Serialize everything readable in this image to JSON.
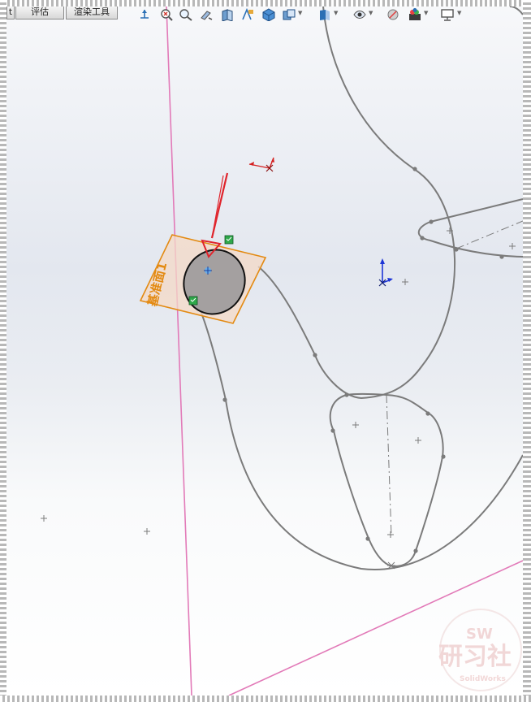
{
  "tabs": [
    {
      "label": "t"
    },
    {
      "label": "评估"
    },
    {
      "label": "渲染工具"
    }
  ],
  "toolbar": {
    "icons": [
      "view-orientation-icon",
      "zoom-to-fit-icon",
      "zoom-area-icon",
      "previous-view-icon",
      "section-view-icon",
      "dynamic-annotation-icon",
      "view-orientation-cube-icon",
      "display-style-icon",
      "hide-show-icon",
      "edit-appearance-icon",
      "apply-scene-icon",
      "view-settings-icon"
    ]
  },
  "viewport": {
    "plane_label": "基准面1",
    "watermark": {
      "top": "SW",
      "main": "研习社",
      "sub": "SolidWorks"
    }
  },
  "colors": {
    "sketch_line": "#7b7b7b",
    "plane_outline": "#e38a12",
    "plane_line": "#e27ab8",
    "arrow_red": "#e0242c",
    "handle_green": "#2fa84a",
    "axis_blue": "#1d35d6"
  }
}
